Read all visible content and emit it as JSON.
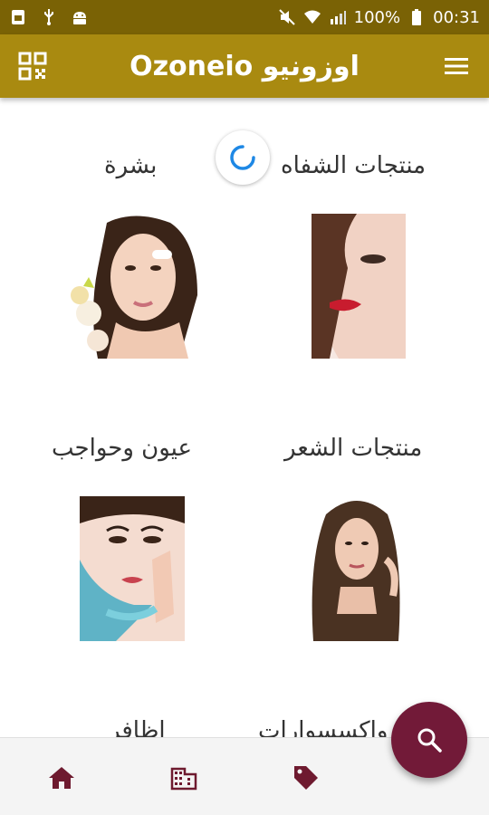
{
  "status_bar": {
    "battery": "100%",
    "time": "00:31"
  },
  "app_bar": {
    "title": "Ozoneio اوزونيو"
  },
  "categories": [
    {
      "label": "منتجات الشفاه"
    },
    {
      "label": "بشرة"
    },
    {
      "label": "منتجات الشعر"
    },
    {
      "label": "عيون وحواجب"
    },
    {
      "label": "واكسسوارات"
    },
    {
      "label": "اظافر"
    }
  ],
  "colors": {
    "status_bar": "#7a6205",
    "app_bar": "#a98a10",
    "fab": "#721a38",
    "nav_icon": "#6e1a2f",
    "spinner": "#1e88e5"
  },
  "icons": {
    "menu": "menu-icon",
    "qr": "qr-code-icon",
    "home": "home-icon",
    "building": "building-icon",
    "tag": "tag-icon",
    "search": "search-icon"
  }
}
